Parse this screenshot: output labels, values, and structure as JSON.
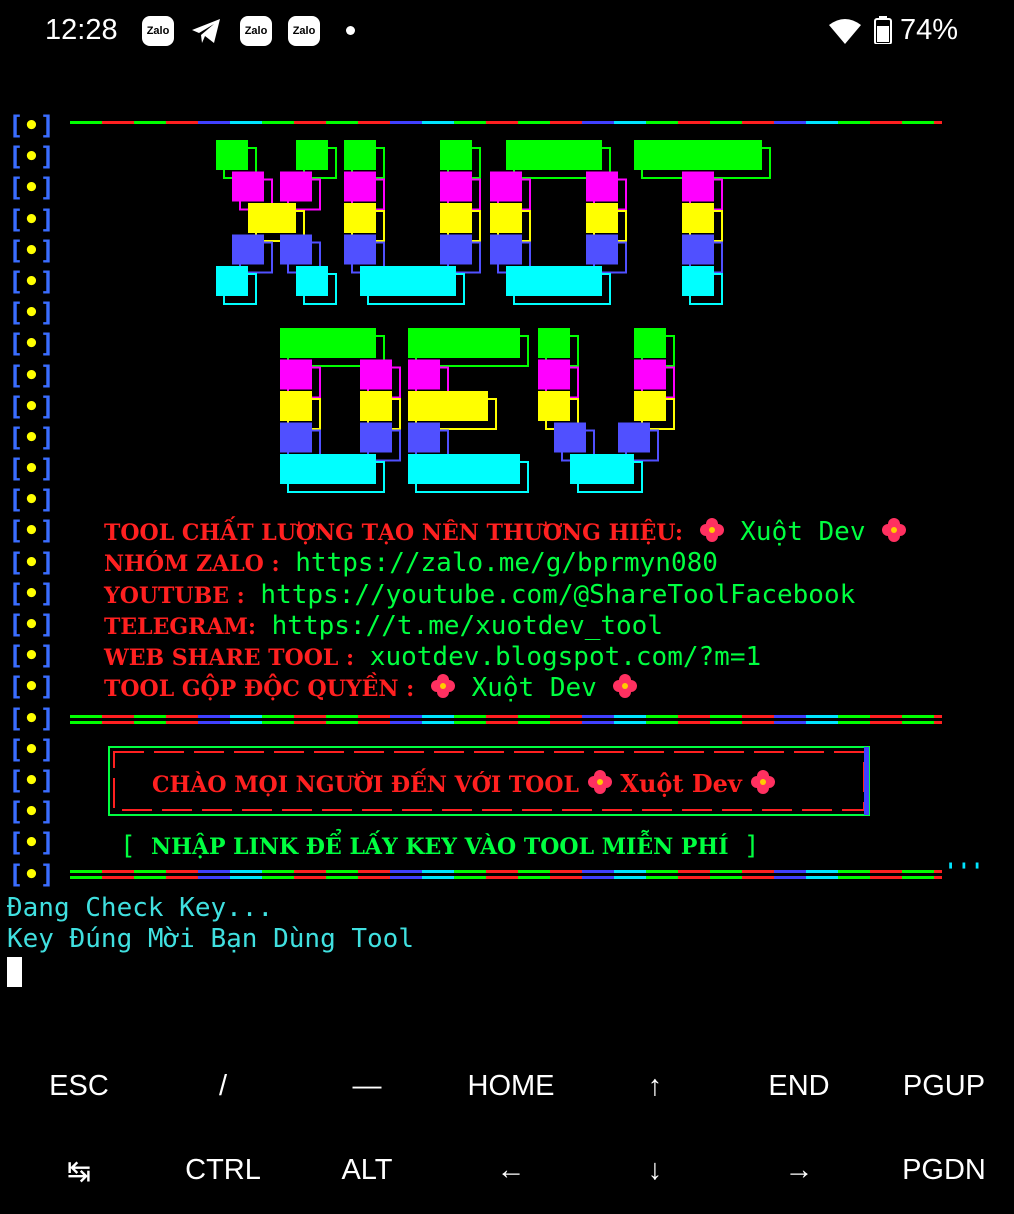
{
  "status_bar": {
    "time": "12:28",
    "notification_icons": [
      "zalo-icon",
      "telegram-icon",
      "zalo-icon",
      "zalo-icon"
    ],
    "zalo_label": "Zalo",
    "battery_percent": "74%",
    "wifi": "wifi-icon",
    "battery": "battery-icon"
  },
  "terminal": {
    "bullet": "[•]",
    "logo_lines": [
      "XUOT",
      "DEV"
    ],
    "info": [
      {
        "label": "TOOL CHẤT LƯỢNG TẠO NÊN THƯƠNG HIỆU:",
        "value": "Xuột Dev"
      },
      {
        "label": "NHÓM ZALO :",
        "value": "https://zalo.me/g/bprmyn080"
      },
      {
        "label": "YOUTUBE :",
        "value": "https://youtube.com/@ShareToolFacebook"
      },
      {
        "label": "TELEGRAM:",
        "value": "https://t.me/xuotdev_tool"
      },
      {
        "label": "WEB SHARE TOOL :",
        "value": "xuotdev.blogspot.com/?m=1"
      },
      {
        "label": "TOOL GỘP ĐỘC QUYỀN :",
        "value": "Xuột Dev"
      }
    ],
    "greeting": "CHÀO MỌI NGƯỜI ĐẾN VỚI TOOL",
    "greeting_brand": "Xuột Dev",
    "bracket_open": "[",
    "instruction": "NHẬP LINK ĐỂ LẤY KEY VÀO TOOL MIỄN PHÍ",
    "bracket_close": "]",
    "ticks": "'''",
    "output_lines": [
      "Đang Check Key...",
      "Key Đúng Mời Bạn Dùng Tool"
    ]
  },
  "colors": {
    "background": "#000000",
    "red": "#ff2020",
    "green": "#00ff40",
    "cyan": "#40e0e0",
    "blue": "#3a6dff",
    "yellow": "#ffff00",
    "magenta": "#ff00ff"
  },
  "extra_keys": {
    "row1": [
      "ESC",
      "/",
      "—",
      "HOME",
      "↑",
      "END",
      "PGUP"
    ],
    "row2": [
      "↹",
      "CTRL",
      "ALT",
      "←",
      "↓",
      "→",
      "PGDN"
    ]
  }
}
